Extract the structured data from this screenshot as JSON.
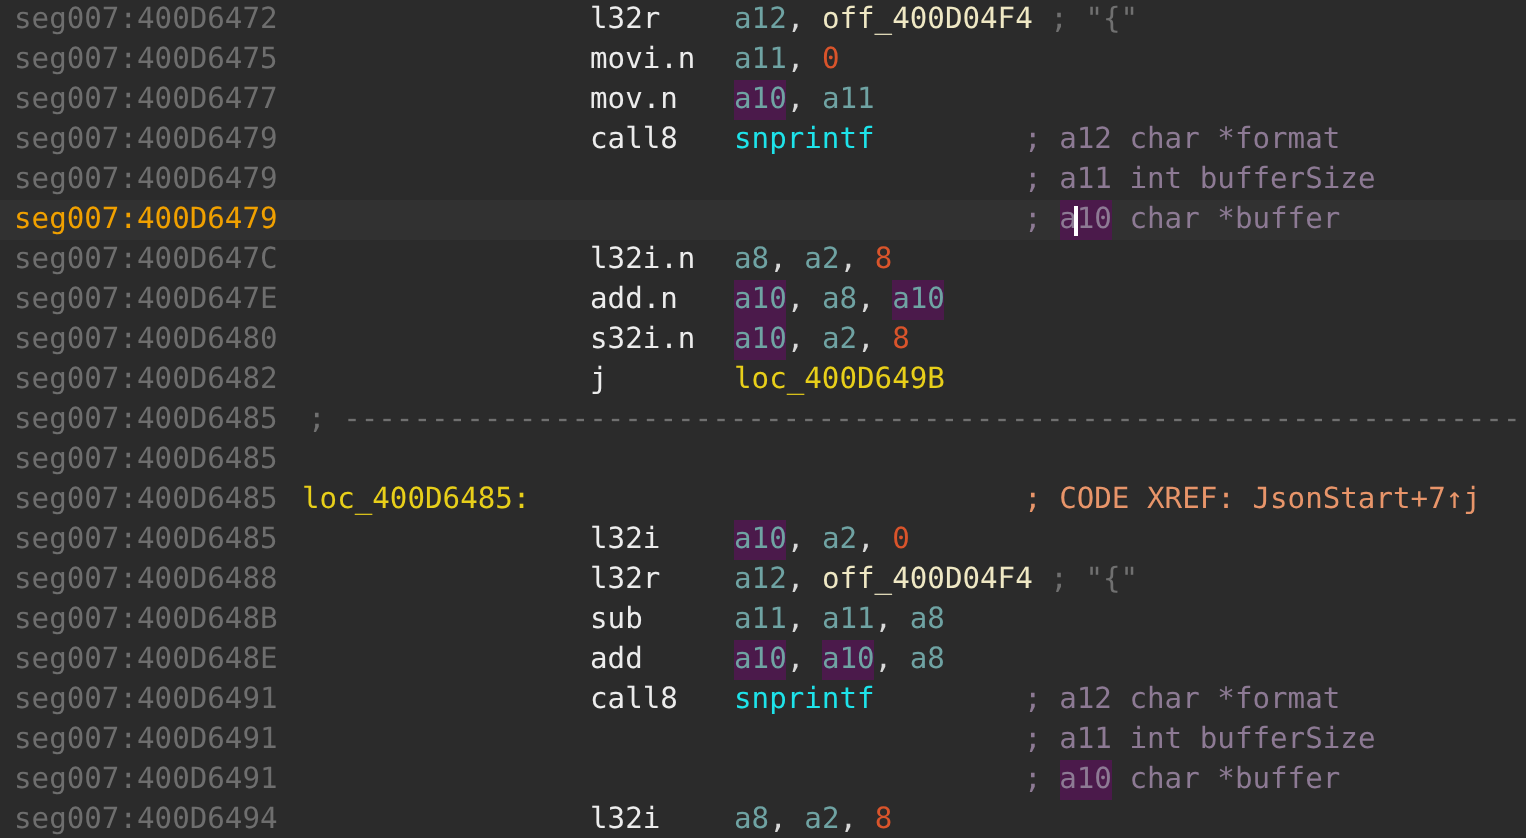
{
  "listing": {
    "lines": [
      {
        "kind": "instruction",
        "address": "seg007:400D6472",
        "selected": false,
        "mnemonic": "l32r",
        "operands": [
          {
            "text": "a12",
            "kind": "reg",
            "highlighted": false
          },
          {
            "text": ", ",
            "kind": "punct",
            "highlighted": false
          },
          {
            "text": "off_400D04F4",
            "kind": "name",
            "highlighted": false
          },
          {
            "text": " ; \"{\"",
            "kind": "note",
            "highlighted": false
          }
        ]
      },
      {
        "kind": "instruction",
        "address": "seg007:400D6475",
        "selected": false,
        "mnemonic": "movi.n",
        "operands": [
          {
            "text": "a11",
            "kind": "reg",
            "highlighted": false
          },
          {
            "text": ", ",
            "kind": "punct",
            "highlighted": false
          },
          {
            "text": "0",
            "kind": "num",
            "highlighted": false
          }
        ]
      },
      {
        "kind": "instruction",
        "address": "seg007:400D6477",
        "selected": false,
        "mnemonic": "mov.n",
        "operands": [
          {
            "text": "a10",
            "kind": "reg",
            "highlighted": true
          },
          {
            "text": ", ",
            "kind": "punct",
            "highlighted": false
          },
          {
            "text": "a11",
            "kind": "reg",
            "highlighted": false
          }
        ]
      },
      {
        "kind": "instruction",
        "address": "seg007:400D6479",
        "selected": false,
        "mnemonic": "call8",
        "operands": [
          {
            "text": "snprintf",
            "kind": "func",
            "highlighted": false
          }
        ],
        "comment": [
          {
            "text": "; ",
            "kind": "arg",
            "highlighted": false
          },
          {
            "text": "a12 char *format",
            "kind": "arg",
            "highlighted": false
          }
        ]
      },
      {
        "kind": "instruction",
        "address": "seg007:400D6479",
        "selected": false,
        "comment": [
          {
            "text": "; ",
            "kind": "arg",
            "highlighted": false
          },
          {
            "text": "a11 int bufferSize",
            "kind": "arg",
            "highlighted": false
          }
        ]
      },
      {
        "kind": "instruction",
        "address": "seg007:400D6479",
        "selected": true,
        "comment": [
          {
            "text": "; ",
            "kind": "arg",
            "highlighted": false
          },
          {
            "text": "a10",
            "kind": "arg",
            "highlighted": true,
            "caret": true
          },
          {
            "text": " char *buffer",
            "kind": "arg",
            "highlighted": false
          }
        ]
      },
      {
        "kind": "instruction",
        "address": "seg007:400D647C",
        "selected": false,
        "mnemonic": "l32i.n",
        "operands": [
          {
            "text": "a8",
            "kind": "reg",
            "highlighted": false
          },
          {
            "text": ", ",
            "kind": "punct",
            "highlighted": false
          },
          {
            "text": "a2",
            "kind": "reg",
            "highlighted": false
          },
          {
            "text": ", ",
            "kind": "punct",
            "highlighted": false
          },
          {
            "text": "8",
            "kind": "num",
            "highlighted": false
          }
        ]
      },
      {
        "kind": "instruction",
        "address": "seg007:400D647E",
        "selected": false,
        "mnemonic": "add.n",
        "operands": [
          {
            "text": "a10",
            "kind": "reg",
            "highlighted": true
          },
          {
            "text": ", ",
            "kind": "punct",
            "highlighted": false
          },
          {
            "text": "a8",
            "kind": "reg",
            "highlighted": false
          },
          {
            "text": ", ",
            "kind": "punct",
            "highlighted": false
          },
          {
            "text": "a10",
            "kind": "reg",
            "highlighted": true
          }
        ]
      },
      {
        "kind": "instruction",
        "address": "seg007:400D6480",
        "selected": false,
        "mnemonic": "s32i.n",
        "operands": [
          {
            "text": "a10",
            "kind": "reg",
            "highlighted": true
          },
          {
            "text": ", ",
            "kind": "punct",
            "highlighted": false
          },
          {
            "text": "a2",
            "kind": "reg",
            "highlighted": false
          },
          {
            "text": ", ",
            "kind": "punct",
            "highlighted": false
          },
          {
            "text": "8",
            "kind": "num",
            "highlighted": false
          }
        ]
      },
      {
        "kind": "instruction",
        "address": "seg007:400D6482",
        "selected": false,
        "mnemonic": "j",
        "operands": [
          {
            "text": "loc_400D649B",
            "kind": "loc",
            "highlighted": false
          }
        ]
      },
      {
        "kind": "separator",
        "address": "seg007:400D6485",
        "selected": false,
        "text": "; -------------------------------------------------------------------"
      },
      {
        "kind": "instruction",
        "address": "seg007:400D6485",
        "selected": false
      },
      {
        "kind": "label",
        "address": "seg007:400D6485",
        "selected": false,
        "label": "loc_400D6485:",
        "comment": [
          {
            "text": "; CODE XREF: JsonStart+7↑j",
            "kind": "xref",
            "highlighted": false
          }
        ]
      },
      {
        "kind": "instruction",
        "address": "seg007:400D6485",
        "selected": false,
        "mnemonic": "l32i",
        "operands": [
          {
            "text": "a10",
            "kind": "reg",
            "highlighted": true
          },
          {
            "text": ", ",
            "kind": "punct",
            "highlighted": false
          },
          {
            "text": "a2",
            "kind": "reg",
            "highlighted": false
          },
          {
            "text": ", ",
            "kind": "punct",
            "highlighted": false
          },
          {
            "text": "0",
            "kind": "num",
            "highlighted": false
          }
        ]
      },
      {
        "kind": "instruction",
        "address": "seg007:400D6488",
        "selected": false,
        "mnemonic": "l32r",
        "operands": [
          {
            "text": "a12",
            "kind": "reg",
            "highlighted": false
          },
          {
            "text": ", ",
            "kind": "punct",
            "highlighted": false
          },
          {
            "text": "off_400D04F4",
            "kind": "name",
            "highlighted": false
          },
          {
            "text": " ; \"{\"",
            "kind": "note",
            "highlighted": false
          }
        ]
      },
      {
        "kind": "instruction",
        "address": "seg007:400D648B",
        "selected": false,
        "mnemonic": "sub",
        "operands": [
          {
            "text": "a11",
            "kind": "reg",
            "highlighted": false
          },
          {
            "text": ", ",
            "kind": "punct",
            "highlighted": false
          },
          {
            "text": "a11",
            "kind": "reg",
            "highlighted": false
          },
          {
            "text": ", ",
            "kind": "punct",
            "highlighted": false
          },
          {
            "text": "a8",
            "kind": "reg",
            "highlighted": false
          }
        ]
      },
      {
        "kind": "instruction",
        "address": "seg007:400D648E",
        "selected": false,
        "mnemonic": "add",
        "operands": [
          {
            "text": "a10",
            "kind": "reg",
            "highlighted": true
          },
          {
            "text": ", ",
            "kind": "punct",
            "highlighted": false
          },
          {
            "text": "a10",
            "kind": "reg",
            "highlighted": true
          },
          {
            "text": ", ",
            "kind": "punct",
            "highlighted": false
          },
          {
            "text": "a8",
            "kind": "reg",
            "highlighted": false
          }
        ]
      },
      {
        "kind": "instruction",
        "address": "seg007:400D6491",
        "selected": false,
        "mnemonic": "call8",
        "operands": [
          {
            "text": "snprintf",
            "kind": "func",
            "highlighted": false
          }
        ],
        "comment": [
          {
            "text": "; ",
            "kind": "arg",
            "highlighted": false
          },
          {
            "text": "a12 char *format",
            "kind": "arg",
            "highlighted": false
          }
        ]
      },
      {
        "kind": "instruction",
        "address": "seg007:400D6491",
        "selected": false,
        "comment": [
          {
            "text": "; ",
            "kind": "arg",
            "highlighted": false
          },
          {
            "text": "a11 int bufferSize",
            "kind": "arg",
            "highlighted": false
          }
        ]
      },
      {
        "kind": "instruction",
        "address": "seg007:400D6491",
        "selected": false,
        "comment": [
          {
            "text": "; ",
            "kind": "arg",
            "highlighted": false
          },
          {
            "text": "a10",
            "kind": "arg",
            "highlighted": true
          },
          {
            "text": " char *buffer",
            "kind": "arg",
            "highlighted": false
          }
        ]
      },
      {
        "kind": "instruction",
        "address": "seg007:400D6494",
        "selected": false,
        "mnemonic": "l32i",
        "operands": [
          {
            "text": "a8",
            "kind": "reg",
            "highlighted": false
          },
          {
            "text": ", ",
            "kind": "punct",
            "highlighted": false
          },
          {
            "text": "a2",
            "kind": "reg",
            "highlighted": false
          },
          {
            "text": ", ",
            "kind": "punct",
            "highlighted": false
          },
          {
            "text": "8",
            "kind": "num",
            "highlighted": false
          }
        ]
      }
    ]
  }
}
